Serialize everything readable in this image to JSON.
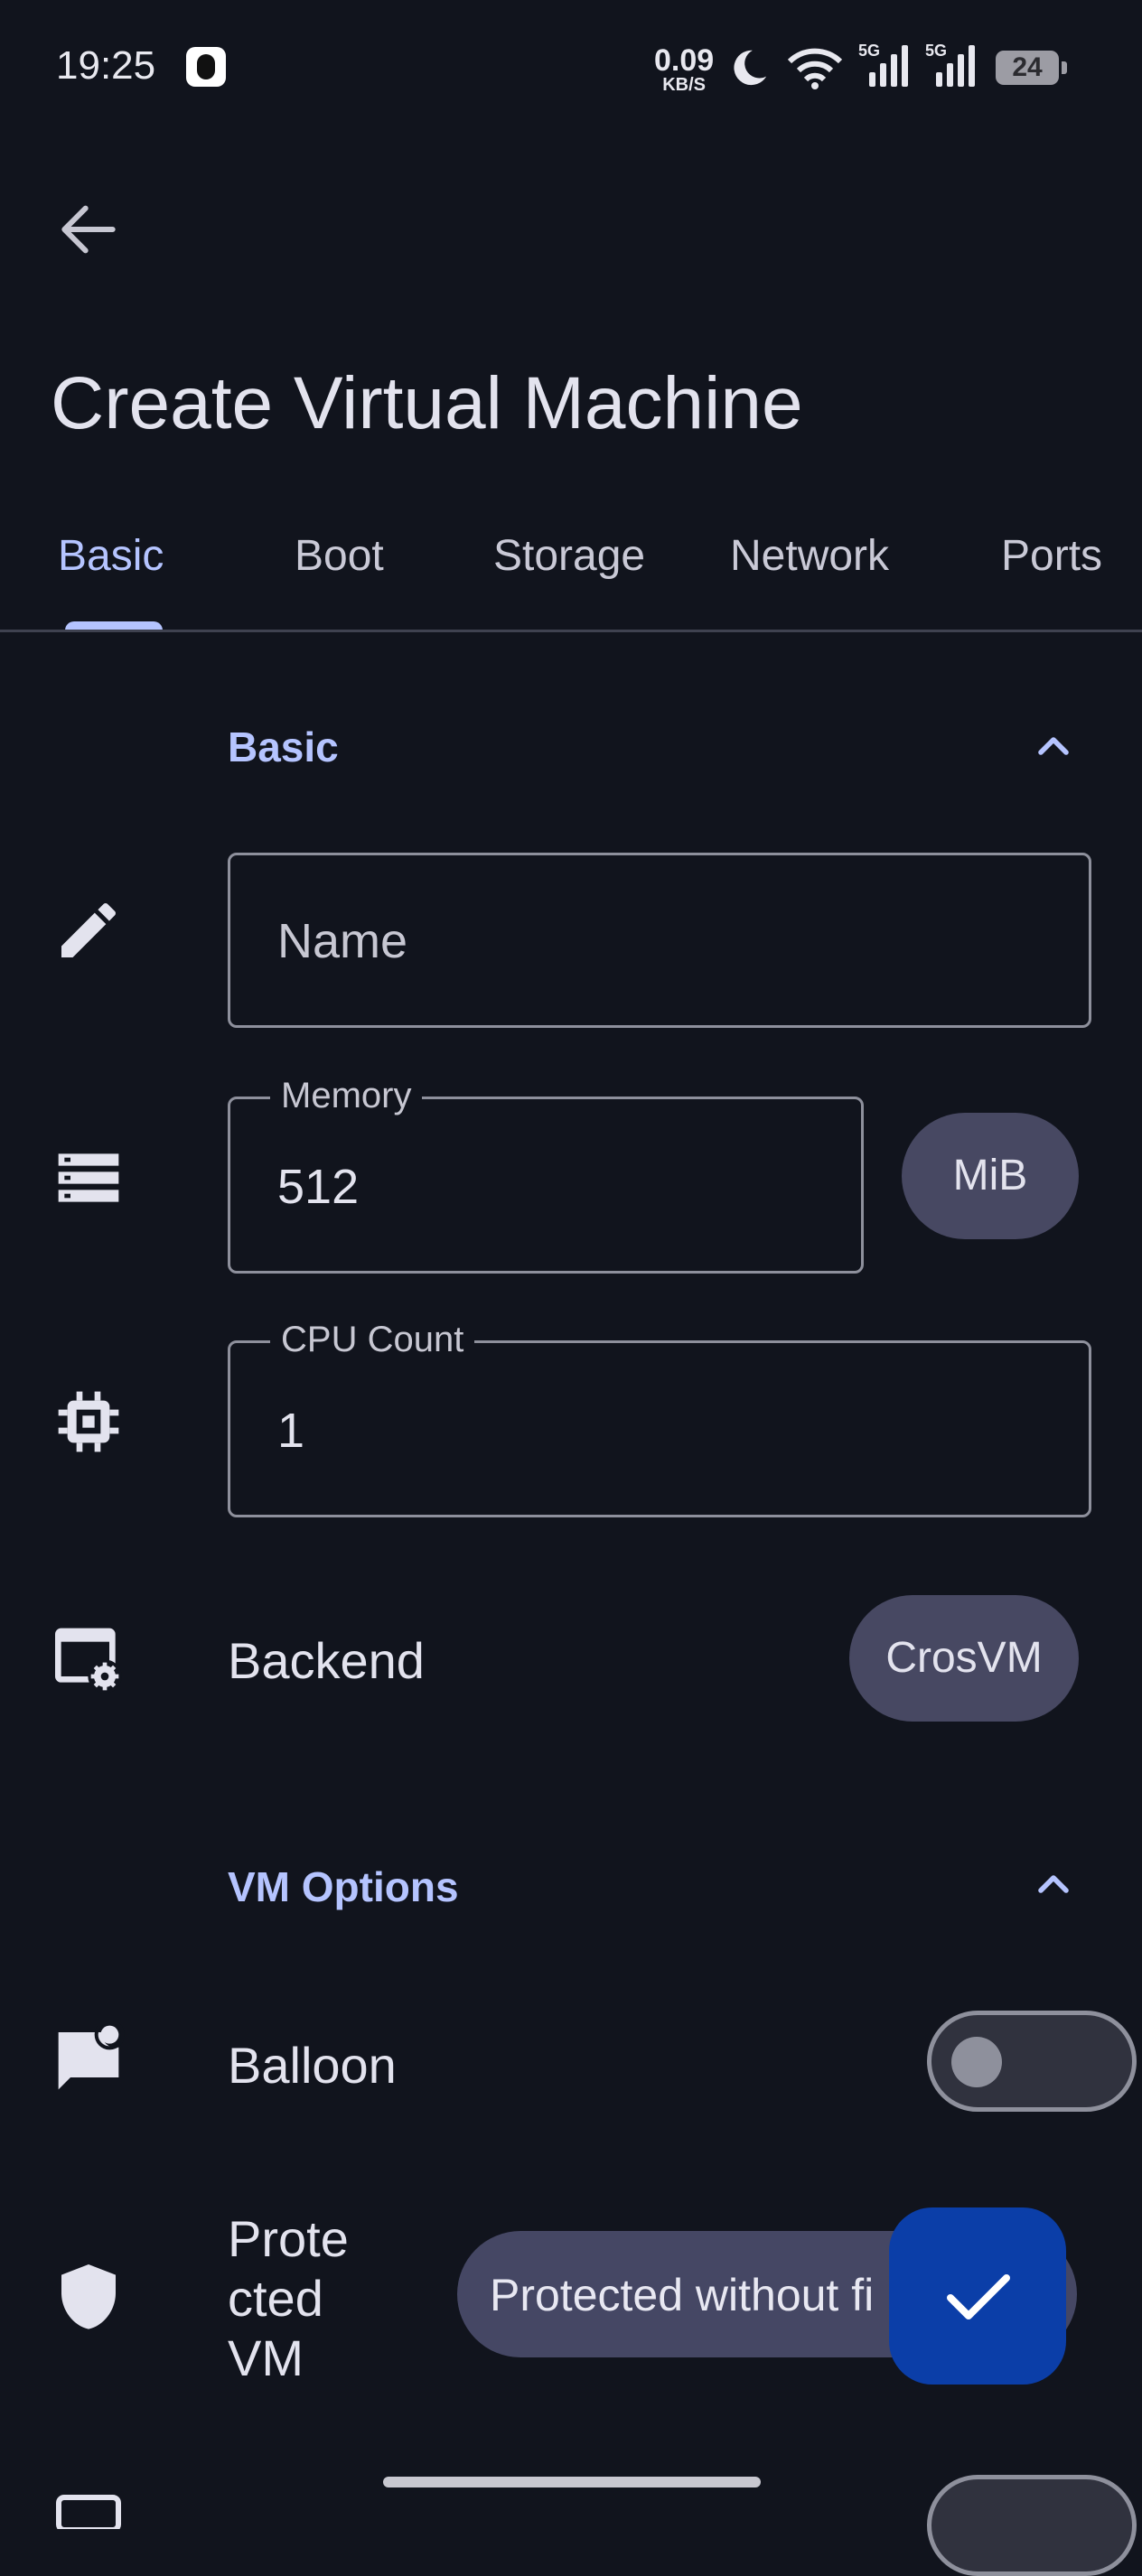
{
  "status_bar": {
    "time": "19:25",
    "net_speed_value": "0.09",
    "net_speed_unit": "KB/S",
    "signal_label_1": "5G",
    "signal_label_2": "5G",
    "battery_level": "24",
    "icons": [
      "qq-icon",
      "moon-icon",
      "wifi-icon",
      "signal-icon",
      "signal-icon",
      "battery-icon"
    ]
  },
  "header": {
    "back_icon": "arrow-left-icon",
    "title": "Create Virtual Machine"
  },
  "tabs": [
    {
      "label": "Basic",
      "active": true
    },
    {
      "label": "Boot",
      "active": false
    },
    {
      "label": "Storage",
      "active": false
    },
    {
      "label": "Network",
      "active": false
    },
    {
      "label": "Ports",
      "active": false
    }
  ],
  "basic_section": {
    "title": "Basic",
    "name_field": {
      "placeholder": "Name",
      "value": ""
    },
    "memory_field": {
      "label": "Memory",
      "value": "512",
      "unit": "MiB"
    },
    "cpu_field": {
      "label": "CPU Count",
      "value": "1"
    },
    "backend": {
      "label": "Backend",
      "value": "CrosVM"
    }
  },
  "vm_options_section": {
    "title": "VM Options",
    "balloon": {
      "label": "Balloon",
      "enabled": false
    },
    "protected_vm": {
      "label_lines": [
        "Prote",
        "cted",
        "VM"
      ]
    }
  },
  "snackbar": {
    "text": "Protected without fi"
  },
  "colors": {
    "background": "#11141d",
    "accent": "#b5c4ff",
    "pill": "#474862",
    "fab": "#0b3ea8"
  }
}
